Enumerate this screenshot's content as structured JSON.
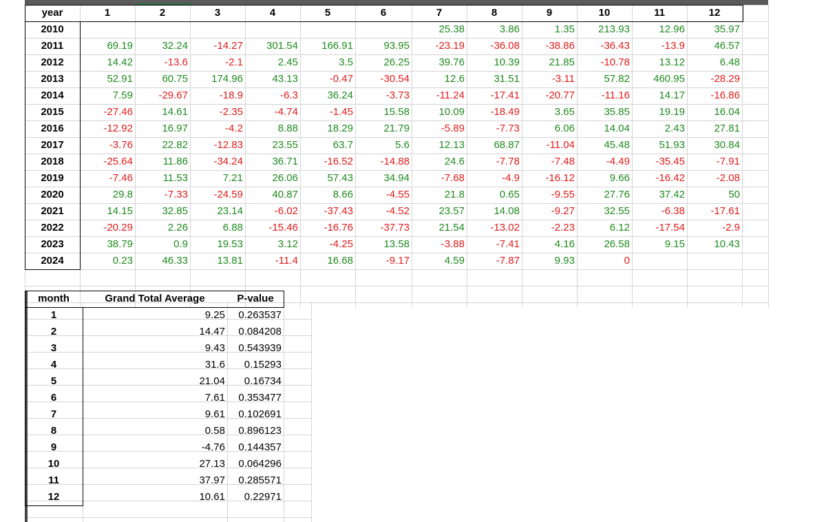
{
  "main_table": {
    "columns": [
      "year",
      "1",
      "2",
      "3",
      "4",
      "5",
      "6",
      "7",
      "8",
      "9",
      "10",
      "11",
      "12"
    ],
    "rows": [
      {
        "year": "2010",
        "values": [
          "",
          "",
          "",
          "",
          "",
          "",
          "25.38",
          "3.86",
          "1.35",
          "213.93",
          "12.96",
          "35.97"
        ]
      },
      {
        "year": "2011",
        "values": [
          "69.19",
          "32.24",
          "-14.27",
          "301.54",
          "166.91",
          "93.95",
          "-23.19",
          "-36.08",
          "-38.86",
          "-36.43",
          "-13.9",
          "46.57"
        ]
      },
      {
        "year": "2012",
        "values": [
          "14.42",
          "-13.6",
          "-2.1",
          "2.45",
          "3.5",
          "26.25",
          "39.76",
          "10.39",
          "21.85",
          "-10.78",
          "13.12",
          "6.48"
        ]
      },
      {
        "year": "2013",
        "values": [
          "52.91",
          "60.75",
          "174.96",
          "43.13",
          "-0.47",
          "-30.54",
          "12.6",
          "31.51",
          "-3.11",
          "57.82",
          "460.95",
          "-28.29"
        ]
      },
      {
        "year": "2014",
        "values": [
          "7.59",
          "-29.67",
          "-18.9",
          "-6.3",
          "36.24",
          "-3.73",
          "-11.24",
          "-17.41",
          "-20.77",
          "-11.16",
          "14.17",
          "-16.86"
        ]
      },
      {
        "year": "2015",
        "values": [
          "-27.46",
          "14.61",
          "-2.35",
          "-4.74",
          "-1.45",
          "15.58",
          "10.09",
          "-18.49",
          "3.65",
          "35.85",
          "19.19",
          "16.04"
        ]
      },
      {
        "year": "2016",
        "values": [
          "-12.92",
          "16.97",
          "-4.2",
          "8.88",
          "18.29",
          "21.79",
          "-5.89",
          "-7.73",
          "6.06",
          "14.04",
          "2.43",
          "27.81"
        ]
      },
      {
        "year": "2017",
        "values": [
          "-3.76",
          "22.82",
          "-12.83",
          "23.55",
          "63.7",
          "5.6",
          "12.13",
          "68.87",
          "-11.04",
          "45.48",
          "51.93",
          "30.84"
        ]
      },
      {
        "year": "2018",
        "values": [
          "-25.64",
          "11.86",
          "-34.24",
          "36.71",
          "-16.52",
          "-14.88",
          "24.6",
          "-7.78",
          "-7.48",
          "-4.49",
          "-35.45",
          "-7.91"
        ]
      },
      {
        "year": "2019",
        "values": [
          "-7.46",
          "11.53",
          "7.21",
          "26.06",
          "57.43",
          "34.94",
          "-7.68",
          "-4.9",
          "-16.12",
          "9.66",
          "-16.42",
          "-2.08"
        ]
      },
      {
        "year": "2020",
        "values": [
          "29.8",
          "-7.33",
          "-24.59",
          "40.87",
          "8.66",
          "-4.55",
          "21.8",
          "0.65",
          "-9.55",
          "27.76",
          "37.42",
          "50"
        ]
      },
      {
        "year": "2021",
        "values": [
          "14.15",
          "32.85",
          "23.14",
          "-6.02",
          "-37.43",
          "-4.52",
          "23.57",
          "14.08",
          "-9.27",
          "32.55",
          "-6.38",
          "-17.61"
        ]
      },
      {
        "year": "2022",
        "values": [
          "-20.29",
          "2.26",
          "6.88",
          "-15.46",
          "-16.76",
          "-37.73",
          "21.54",
          "-13.02",
          "-2.23",
          "6.12",
          "-17.54",
          "-2.9"
        ]
      },
      {
        "year": "2023",
        "values": [
          "38.79",
          "0.9",
          "19.53",
          "3.12",
          "-4.25",
          "13.58",
          "-3.88",
          "-7.41",
          "4.16",
          "26.58",
          "9.15",
          "10.43"
        ]
      },
      {
        "year": "2024",
        "values": [
          "0.23",
          "46.33",
          "13.81",
          "-11.4",
          "16.68",
          "-9.17",
          "4.59",
          "-7.87",
          "9.93",
          "0",
          "",
          ""
        ]
      }
    ]
  },
  "summary_table": {
    "headers": [
      "month",
      "Grand Total Average",
      "P-value"
    ],
    "rows": [
      {
        "month": "1",
        "avg": "9.25",
        "p": "0.263537"
      },
      {
        "month": "2",
        "avg": "14.47",
        "p": "0.084208"
      },
      {
        "month": "3",
        "avg": "9.43",
        "p": "0.543939"
      },
      {
        "month": "4",
        "avg": "31.6",
        "p": "0.15293"
      },
      {
        "month": "5",
        "avg": "21.04",
        "p": "0.16734"
      },
      {
        "month": "6",
        "avg": "7.61",
        "p": "0.353477"
      },
      {
        "month": "7",
        "avg": "9.61",
        "p": "0.102691"
      },
      {
        "month": "8",
        "avg": "0.58",
        "p": "0.896123"
      },
      {
        "month": "9",
        "avg": "-4.76",
        "p": "0.144357"
      },
      {
        "month": "10",
        "avg": "27.13",
        "p": "0.064296"
      },
      {
        "month": "11",
        "avg": "37.97",
        "p": "0.285571"
      },
      {
        "month": "12",
        "avg": "10.61",
        "p": "0.22971"
      }
    ]
  },
  "colors": {
    "positive": "#1e8a1e",
    "negative": "#e01b1b",
    "grid": "#d4d4d4"
  }
}
